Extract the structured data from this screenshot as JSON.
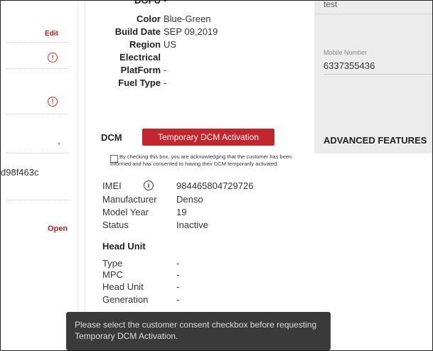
{
  "left_panel": {
    "edit_label": "Edit",
    "vin_fragment": "d98f463c",
    "open_label": "Open",
    "alert_glyph": "!",
    "caret_glyph": "▾"
  },
  "vehicle": {
    "top_partial_label": "DOFU",
    "top_partial_value": "-",
    "color_label": "Color",
    "color_value": "Blue-Green",
    "build_date_label": "Build Date",
    "build_date_value": "SEP 09,2019",
    "region_label": "Region",
    "region_value": "US",
    "electrical_label": "Electrical",
    "platform_label": "PlatForm",
    "platform_value": "-",
    "fuel_type_label": "Fuel Type",
    "fuel_type_value": "-"
  },
  "dcm": {
    "title": "DCM",
    "activation_button": "Temporary DCM Activation",
    "consent_text": "By checking this box, you are acknowledging that the customer has been informed and has consented to having their DCM temporarily activated.",
    "imei_label": "IMEI",
    "imei_value": "984465804729726",
    "manufacturer_label": "Manufacturer",
    "manufacturer_value": "Denso",
    "model_year_label": "Model Year",
    "model_year_value": "19",
    "status_label": "Status",
    "status_value": "Inactive",
    "info_glyph": "i"
  },
  "head_unit": {
    "title": "Head Unit",
    "type_label": "Type",
    "type_value": "-",
    "mpc_label": "MPC",
    "mpc_value": "-",
    "head_unit_label": "Head Unit",
    "head_unit_value": "-",
    "generation_label": "Generation",
    "generation_value": "-"
  },
  "right_panel": {
    "top_value": "test",
    "mobile_label": "Mobile Number",
    "mobile_value": "6337355436",
    "advanced_title": "ADVANCED FEATURES"
  },
  "toast": {
    "message": "Please select the customer consent checkbox before requesting Temporary DCM Activation."
  }
}
